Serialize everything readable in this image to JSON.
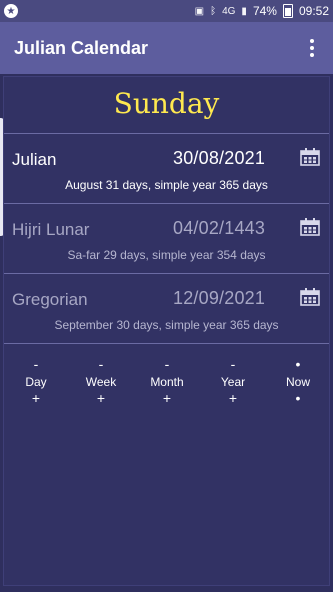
{
  "statusbar": {
    "battery": "74%",
    "time": "09:52",
    "signal": "4G"
  },
  "app": {
    "title": "Julian Calendar"
  },
  "day": {
    "name": "Sunday"
  },
  "calendars": [
    {
      "name": "Julian",
      "date": "30/08/2021",
      "desc": "August 31 days, simple year 365 days",
      "active": true
    },
    {
      "name": "Hijri Lunar",
      "date": "04/02/1443",
      "desc": "Sa-far 29 days, simple year 354 days",
      "active": false
    },
    {
      "name": "Gregorian",
      "date": "12/09/2021",
      "desc": "September 30 days, simple year 365 days",
      "active": false
    }
  ],
  "controls": [
    {
      "minus": "-",
      "label": "Day",
      "plus": "+"
    },
    {
      "minus": "-",
      "label": "Week",
      "plus": "+"
    },
    {
      "minus": "-",
      "label": "Month",
      "plus": "+"
    },
    {
      "minus": "-",
      "label": "Year",
      "plus": "+"
    },
    {
      "minus": "•",
      "label": "Now",
      "plus": "•"
    }
  ],
  "icons": {
    "menu": "more-vert-icon",
    "calendar": "calendar-icon",
    "notification": "notification-icon",
    "bluetooth": "bluetooth-icon",
    "signal": "signal-icon",
    "battery": "battery-icon"
  },
  "colors": {
    "appbar": "#5d5d9e",
    "panel": "#323264",
    "dayname": "#ffe94f"
  }
}
